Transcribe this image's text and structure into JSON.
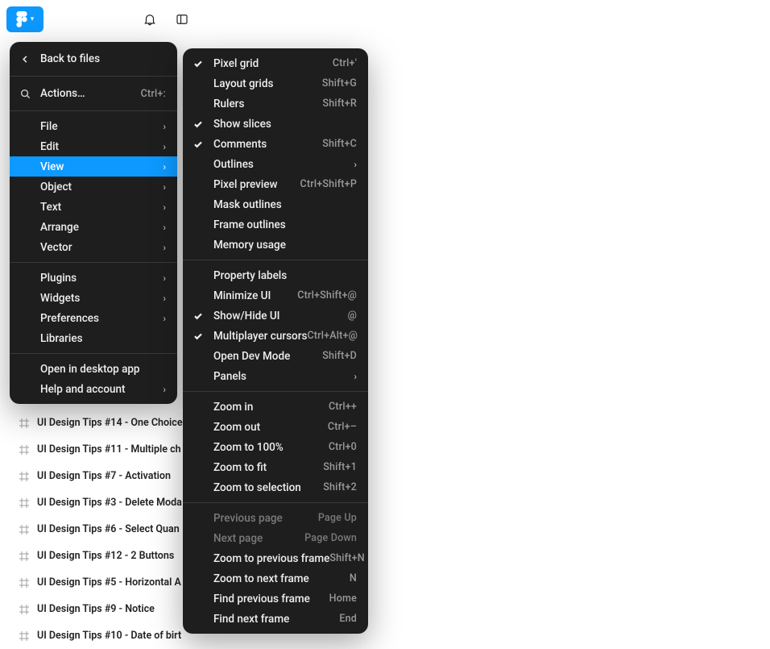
{
  "toolbar": {
    "figma_tooltip": "Main menu",
    "notifications_tooltip": "Notifications",
    "panel_tooltip": "Toggle panel"
  },
  "layers": {
    "items": [
      "UI Design Tips #14 - One Choice",
      "UI Design Tips #11 - Multiple ch",
      "UI Design Tips #7 - Activation",
      "UI Design Tips #3 - Delete Moda",
      "UI Design Tips #6 - Select Quan",
      "UI Design Tips #12 - 2 Buttons",
      "UI Design Tips #5 - Horizontal A",
      "UI Design Tips #9 - Notice",
      "UI Design Tips #10 - Date of birt"
    ]
  },
  "main_menu": {
    "back": "Back to files",
    "actions": "Actions…",
    "actions_short": "Ctrl+:",
    "file": "File",
    "edit": "Edit",
    "view": "View",
    "object": "Object",
    "text": "Text",
    "arrange": "Arrange",
    "vector": "Vector",
    "plugins": "Plugins",
    "widgets": "Widgets",
    "preferences": "Preferences",
    "libraries": "Libraries",
    "open_desktop": "Open in desktop app",
    "help": "Help and account"
  },
  "view_menu": {
    "pixel_grid": {
      "label": "Pixel grid",
      "short": "Ctrl+'",
      "checked": true
    },
    "layout_grids": {
      "label": "Layout grids",
      "short": "Shift+G",
      "checked": false
    },
    "rulers": {
      "label": "Rulers",
      "short": "Shift+R",
      "checked": false
    },
    "show_slices": {
      "label": "Show slices",
      "short": "",
      "checked": true
    },
    "comments": {
      "label": "Comments",
      "short": "Shift+C",
      "checked": true
    },
    "outlines": {
      "label": "Outlines",
      "submenu": true
    },
    "pixel_preview": {
      "label": "Pixel preview",
      "short": "Ctrl+Shift+P"
    },
    "mask_outlines": {
      "label": "Mask outlines"
    },
    "frame_outlines": {
      "label": "Frame outlines"
    },
    "memory_usage": {
      "label": "Memory usage"
    },
    "property_labels": {
      "label": "Property labels"
    },
    "minimize_ui": {
      "label": "Minimize UI",
      "short": "Ctrl+Shift+@"
    },
    "show_hide_ui": {
      "label": "Show/Hide UI",
      "short": "@",
      "checked": true
    },
    "multiplayer_cursors": {
      "label": "Multiplayer cursors",
      "short": "Ctrl+Alt+@",
      "checked": true
    },
    "open_dev_mode": {
      "label": "Open Dev Mode",
      "short": "Shift+D"
    },
    "panels": {
      "label": "Panels",
      "submenu": true
    },
    "zoom_in": {
      "label": "Zoom in",
      "short": "Ctrl++"
    },
    "zoom_out": {
      "label": "Zoom out",
      "short": "Ctrl+–"
    },
    "zoom_100": {
      "label": "Zoom to 100%",
      "short": "Ctrl+0"
    },
    "zoom_fit": {
      "label": "Zoom to fit",
      "short": "Shift+1"
    },
    "zoom_selection": {
      "label": "Zoom to selection",
      "short": "Shift+2"
    },
    "prev_page": {
      "label": "Previous page",
      "short": "Page Up",
      "disabled": true
    },
    "next_page": {
      "label": "Next page",
      "short": "Page Down",
      "disabled": true
    },
    "zoom_prev_frame": {
      "label": "Zoom to previous frame",
      "short": "Shift+N"
    },
    "zoom_next_frame": {
      "label": "Zoom to next frame",
      "short": "N"
    },
    "find_prev_frame": {
      "label": "Find previous frame",
      "short": "Home"
    },
    "find_next_frame": {
      "label": "Find next frame",
      "short": "End"
    }
  }
}
